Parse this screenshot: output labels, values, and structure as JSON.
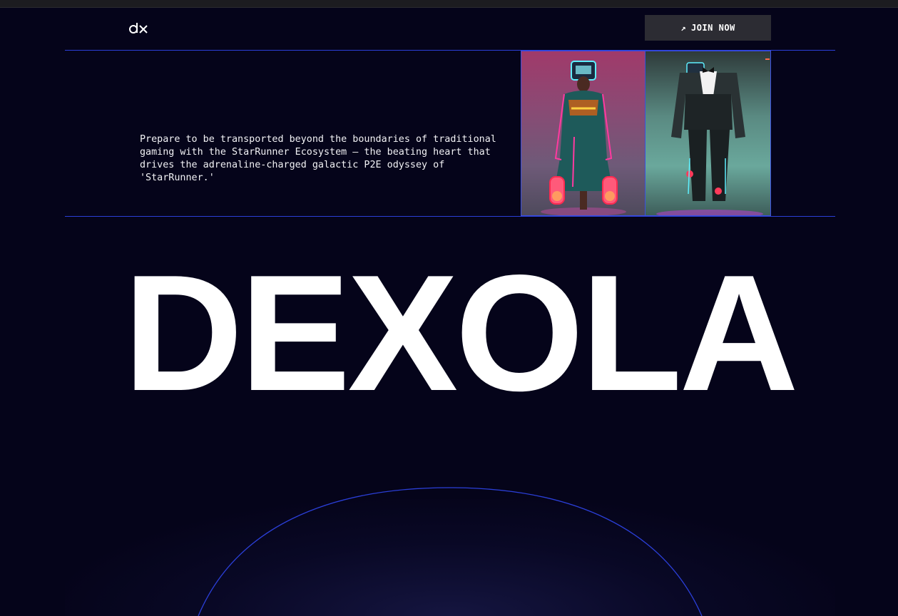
{
  "header": {
    "logo_text": "dx",
    "join_button": {
      "label": "JOIN NOW",
      "icon": "arrow-up-right-icon"
    }
  },
  "intro": {
    "text": "Prepare to be transported beyond the boundaries of traditional gaming with the StarRunner Ecosystem — the beating heart that drives the adrenaline-charged galactic P2E odyssey of 'StarRunner.'"
  },
  "gallery": {
    "cards": [
      {
        "name": "character-card-1",
        "subject": "neon cyber character in robe"
      },
      {
        "name": "character-card-2",
        "subject": "cyber suit tuxedo figure"
      }
    ]
  },
  "hero": {
    "title": "DEXOLA"
  },
  "colors": {
    "background": "#05041a",
    "accent_line": "#2b3fd8",
    "button_bg": "#2c2c33",
    "text": "#ffffff"
  }
}
